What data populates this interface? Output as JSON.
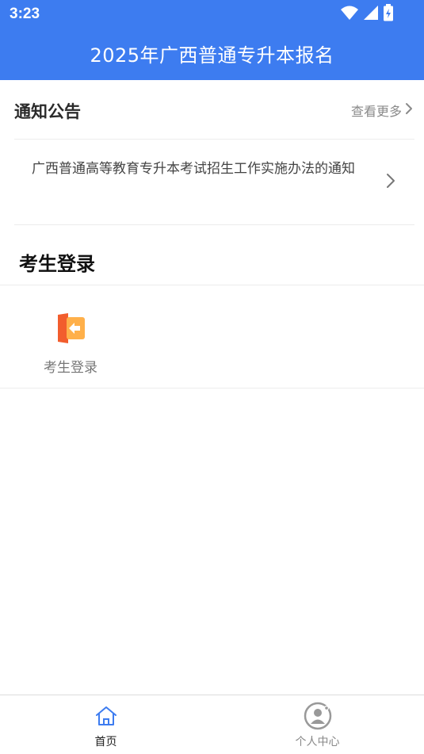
{
  "status_bar": {
    "time": "3:23"
  },
  "header": {
    "title": "2025年广西普通专升本报名",
    "accent_color": "#3d7cf0"
  },
  "notice": {
    "section_title": "通知公告",
    "more_label": "查看更多",
    "items": [
      {
        "text": "广西普通高等教育专升本考试招生工作实施办法的通知"
      }
    ]
  },
  "login": {
    "section_title": "考生登录",
    "tiles": [
      {
        "label": "考生登录",
        "icon": "login-door-icon"
      }
    ]
  },
  "tabbar": {
    "tabs": [
      {
        "label": "首页",
        "icon": "home-icon",
        "active": true
      },
      {
        "label": "个人中心",
        "icon": "user-center-icon",
        "active": false
      }
    ]
  }
}
